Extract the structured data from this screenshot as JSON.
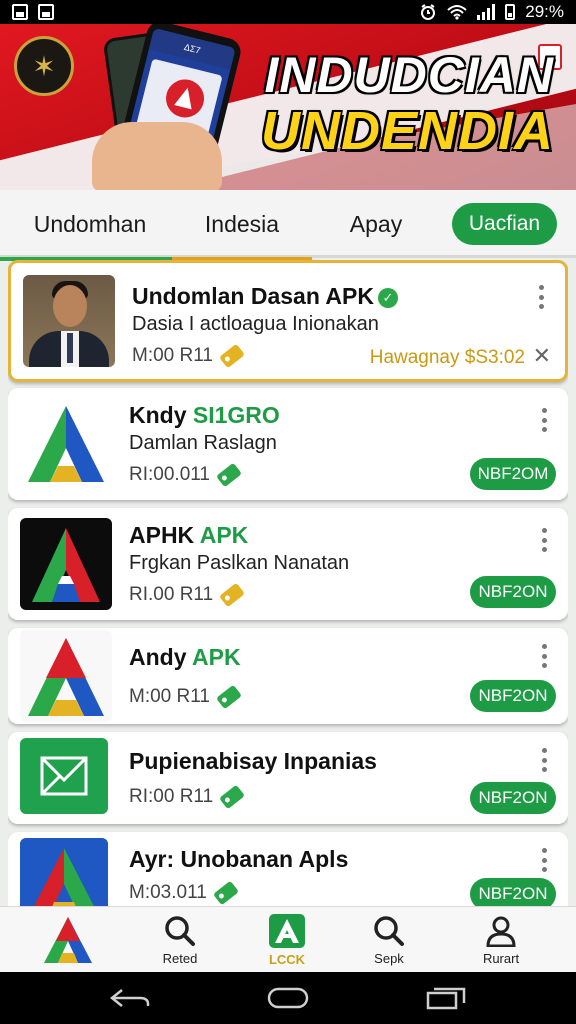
{
  "status_bar": {
    "battery": "29:%"
  },
  "banner": {
    "title_line1": "INDUDCIAN",
    "title_line2": "UNDENDIA",
    "phone_header": "ΔΣ7"
  },
  "tabs": [
    {
      "label": "Undomhan"
    },
    {
      "label": "Indesia"
    },
    {
      "label": "Apay"
    },
    {
      "label": "Uacfian"
    }
  ],
  "apps": [
    {
      "name": "Undomlan Dasan APK",
      "name_highlight": "",
      "desc": "Dasia I actloagua Inionakan",
      "meta": "M:00 R11",
      "price": "Hawagnay $S3:02",
      "action": ""
    },
    {
      "name": "Kndy ",
      "name_highlight": "SI1GRO",
      "desc": "Damlan Raslagn",
      "meta": "RI:00.011",
      "action": "NBF2OM"
    },
    {
      "name": "APHK ",
      "name_highlight": "APK",
      "desc": "Frgkan Paslkan Nanatan",
      "meta": "RI.00 R11",
      "action": "NBF2ON"
    },
    {
      "name": "Andy ",
      "name_highlight": "APK",
      "desc": "",
      "meta": "M:00 R11",
      "action": "NBF2ON"
    },
    {
      "name": "Pupienabisay Inpanias",
      "name_highlight": "",
      "desc": "",
      "meta": "RI:00 R11",
      "action": "NBF2ON"
    },
    {
      "name": "Ayr: Unobanan Apls",
      "name_highlight": "",
      "desc": "",
      "meta": "M:03.011",
      "action": "NBF2ON"
    }
  ],
  "bottom_nav": [
    {
      "label": "",
      "icon": "app-logo-icon"
    },
    {
      "label": "Reted",
      "icon": "search-icon"
    },
    {
      "label": "LCCK",
      "icon": "store-a-icon"
    },
    {
      "label": "Sepk",
      "icon": "search-icon"
    },
    {
      "label": "Rurart",
      "icon": "person-icon"
    }
  ],
  "colors": {
    "accent_green": "#1e9c45",
    "banner_red": "#d8202a",
    "highlight_gold": "#e3b324"
  }
}
